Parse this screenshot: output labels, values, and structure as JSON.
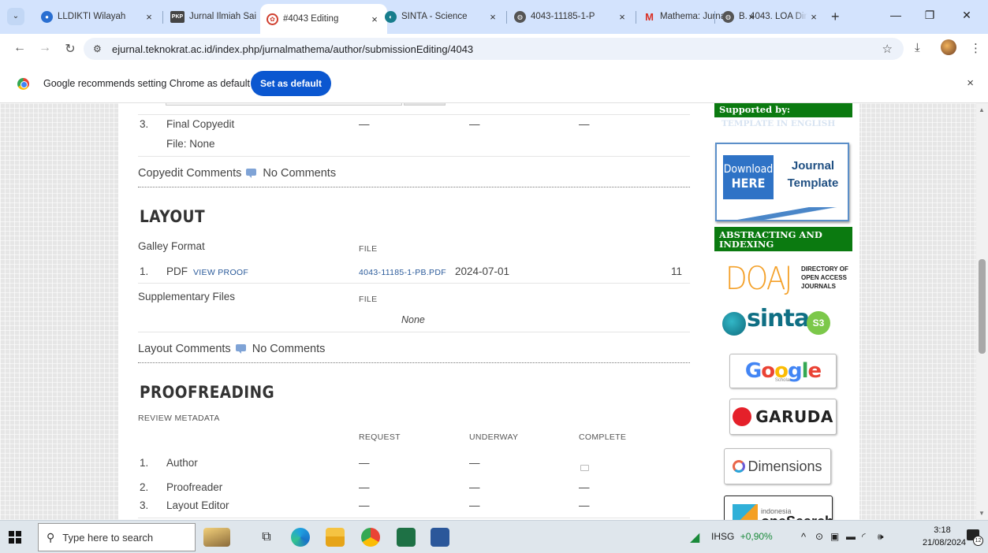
{
  "browser": {
    "tabs": [
      {
        "title": "LLDIKTI Wilayah",
        "favicon": "lldikti"
      },
      {
        "title": "Jurnal Ilmiah Sai",
        "favicon": "PKP"
      },
      {
        "title": "#4043 Editing",
        "favicon": "teknokrat",
        "active": true
      },
      {
        "title": "SINTA - Science",
        "favicon": "sinta"
      },
      {
        "title": "4043-11185-1-P",
        "favicon": "globe"
      },
      {
        "title": "Mathema: Jurna",
        "favicon": "M"
      },
      {
        "title": "B. 4043. LOA Din",
        "favicon": "globe"
      }
    ],
    "tab_close": "×",
    "new_tab": "+",
    "url": "ejurnal.teknokrat.ac.id/index.php/jurnalmathema/author/submissionEditing/4043",
    "infobar": {
      "message": "Google recommends setting Chrome as default",
      "button": "Set as default",
      "close": "×"
    }
  },
  "page": {
    "copyedit": {
      "step_num": "3.",
      "step_label": "Final Copyedit",
      "dash": "—",
      "file_label": "File: None",
      "comments_label": "Copyedit Comments",
      "comments_value": "No Comments"
    },
    "layout": {
      "heading": "LAYOUT",
      "galley_label": "Galley Format",
      "file_col": "FILE",
      "row_num": "1.",
      "row_format": "PDF",
      "view_proof": "VIEW PROOF",
      "file_name": "4043-11185-1-PB.PDF",
      "file_date": "2024-07-01",
      "file_count": "11",
      "supp_label": "Supplementary Files",
      "supp_file_col": "FILE",
      "supp_none": "None",
      "comments_label": "Layout Comments",
      "comments_value": "No Comments"
    },
    "proofreading": {
      "heading": "PROOFREADING",
      "review_metadata": "REVIEW METADATA",
      "col_request": "REQUEST",
      "col_underway": "UNDERWAY",
      "col_complete": "COMPLETE",
      "rows": [
        {
          "num": "1.",
          "label": "Author",
          "request": "—",
          "underway": "—",
          "complete": ""
        },
        {
          "num": "2.",
          "label": "Proofreader",
          "request": "—",
          "underway": "—",
          "complete": "—"
        },
        {
          "num": "3.",
          "label": "Layout Editor",
          "request": "—",
          "underway": "—",
          "complete": "—"
        }
      ]
    }
  },
  "sidebar": {
    "supported_by": "Supported by:",
    "template_faded": "TEMPLATE IN ENGLISH",
    "template_download": "Download",
    "template_here": "HERE",
    "template_journal": "Journal",
    "template_template": "Template",
    "abstracting_title": "ABSTRACTING AND INDEXING",
    "doaj_big": "DOAJ",
    "doaj_l1": "DIRECTORY OF",
    "doaj_l2": "OPEN ACCESS",
    "doaj_l3": "JOURNALS",
    "sinta_word": "sinta",
    "sinta_badge": "S3",
    "google_g": "G",
    "google_o1": "o",
    "google_o2": "o",
    "google_g2": "g",
    "google_l": "l",
    "google_e": "e",
    "google_sub": "Scholar",
    "garuda": "GARUDA",
    "dimensions": "Dimensions",
    "onesearch_small": "indonesia",
    "onesearch_big": "oneSearch"
  },
  "taskbar": {
    "search_placeholder": "Type here to search",
    "ihsg_label": "IHSG",
    "ihsg_value": "+0,90%",
    "time": "3:18",
    "date": "21/08/2024",
    "notifications": "12"
  },
  "colors": {
    "active_tab": "#ffffff",
    "tabstrip": "#d3e3fd",
    "set_default_btn": "#0b57d0",
    "sidebar_green": "#0b7a10",
    "ihsg_positive": "#1a8a3a"
  }
}
